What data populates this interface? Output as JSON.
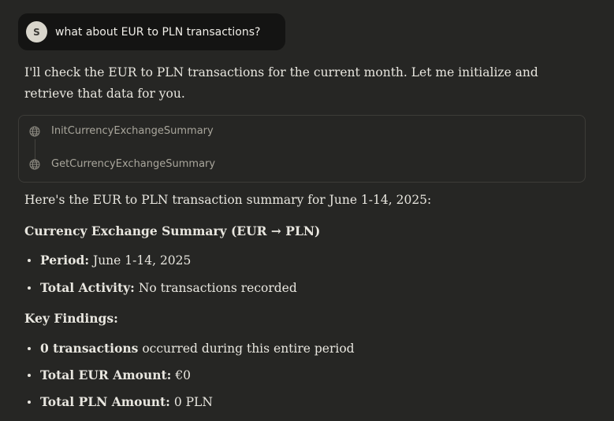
{
  "user_message": {
    "avatar_initial": "S",
    "text": "what about EUR to PLN transactions?"
  },
  "assistant": {
    "intro_text": "I'll check the EUR to PLN transactions for the current month. Let me initialize and retrieve that data for you.",
    "tools": [
      {
        "icon": "globe-icon",
        "label": "InitCurrencyExchangeSummary"
      },
      {
        "icon": "globe-icon",
        "label": "GetCurrencyExchangeSummary"
      }
    ],
    "summary_intro": "Here's the EUR to PLN transaction summary for June 1-14, 2025:",
    "summary_heading": "Currency Exchange Summary (EUR → PLN)",
    "summary_items": [
      {
        "label": "Period:",
        "value": " June 1-14, 2025"
      },
      {
        "label": "Total Activity:",
        "value": " No transactions recorded"
      }
    ],
    "findings_heading": "Key Findings:",
    "findings_items": [
      {
        "label": "0 transactions",
        "value": " occurred during this entire period"
      },
      {
        "label": "Total EUR Amount:",
        "value": " €0"
      },
      {
        "label": "Total PLN Amount:",
        "value": " 0 PLN"
      }
    ]
  }
}
